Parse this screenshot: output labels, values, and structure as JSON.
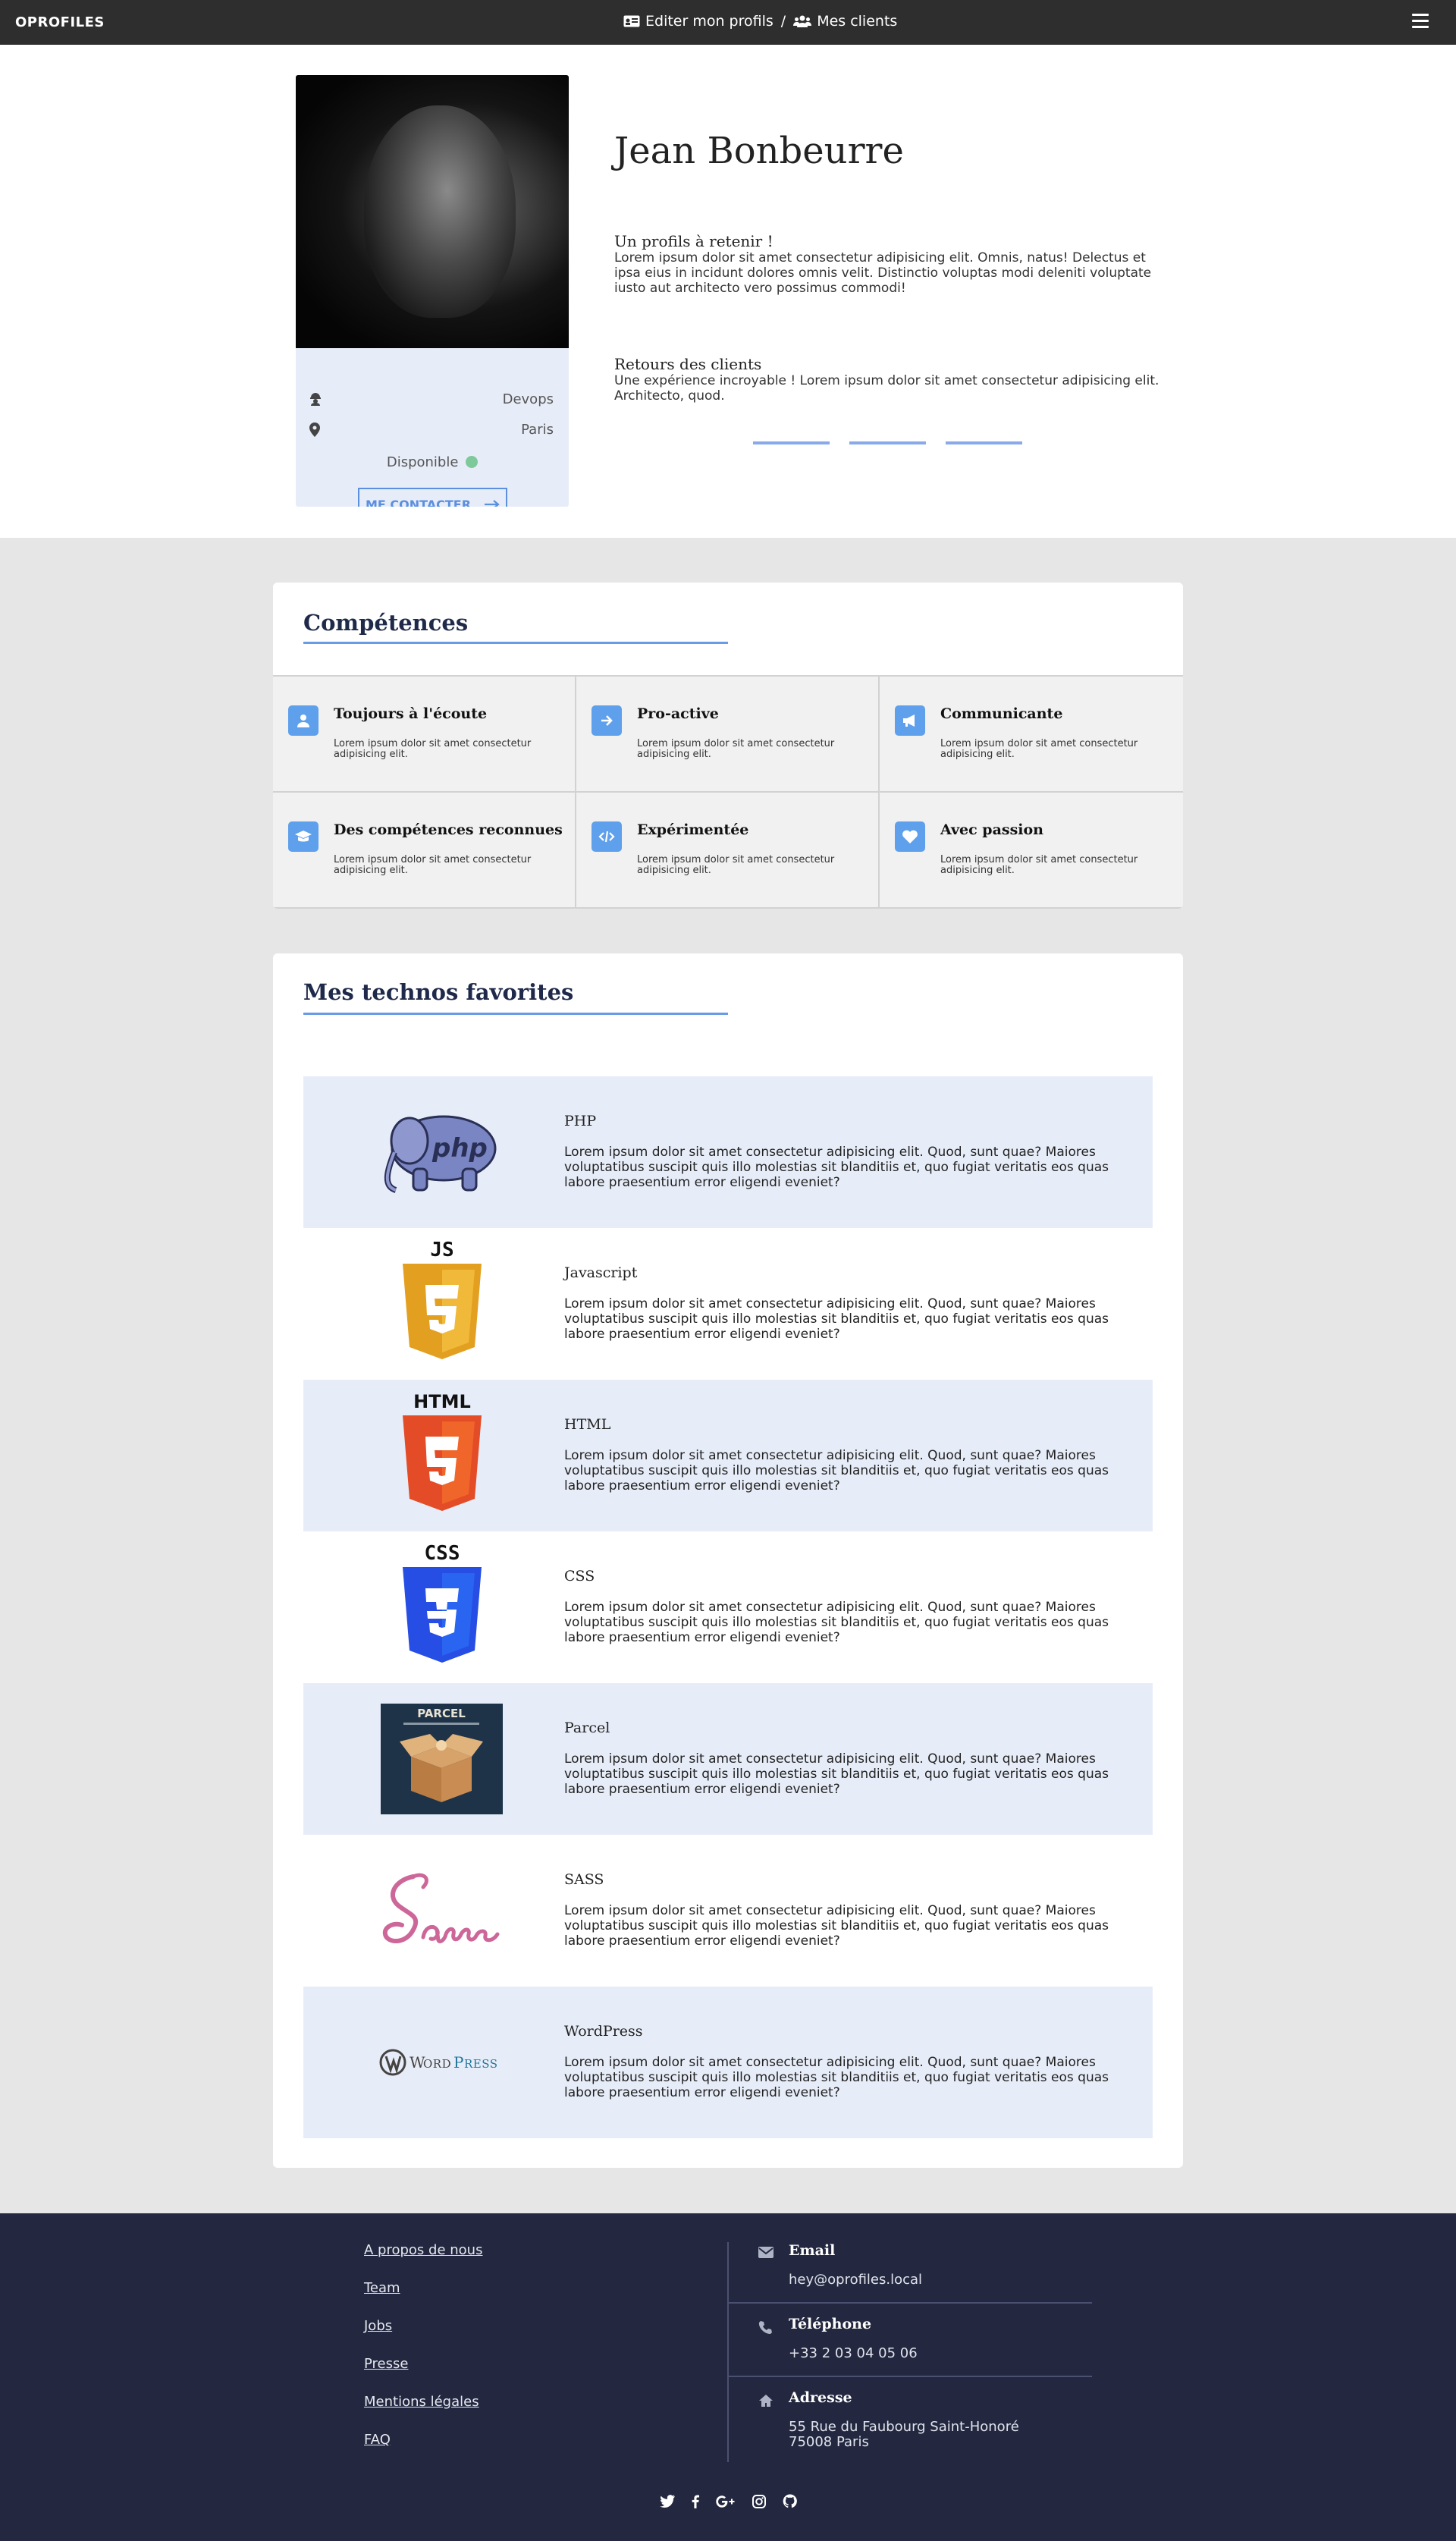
{
  "nav": {
    "brand": "OPROFILES",
    "edit_profile": "Editer mon profils",
    "separator": "/",
    "clients": "Mes clients",
    "icons": [
      "id-card-icon",
      "users-icon",
      "hamburger-menu-icon"
    ]
  },
  "profile": {
    "name": "Jean Bonbeurre",
    "job": "Devops",
    "city": "Paris",
    "availability": "Disponible",
    "availability_color": "#7ec99a",
    "contact_button": "ME CONTACTER",
    "bio_title": "Un profils à retenir !",
    "bio_text": "Lorem ipsum dolor sit amet consectetur adipisicing elit. Omnis, natus! Delectus et ipsa eius in incidunt dolores omnis velit. Distinctio voluptas modi deleniti voluptate iusto aut architecto vero possimus commodi!",
    "reviews_title": "Retours des clients",
    "reviews_text": "Une expérience incroyable ! Lorem ipsum dolor sit amet consectetur adipisicing elit. Architecto, quod."
  },
  "skills": {
    "title": "Compétences",
    "items": [
      {
        "title": "Toujours à l'écoute",
        "text": "Lorem ipsum dolor sit amet consectetur adipisicing elit.",
        "icon": "user-icon"
      },
      {
        "title": "Pro-active",
        "text": "Lorem ipsum dolor sit amet consectetur adipisicing elit.",
        "icon": "arrow-right-icon"
      },
      {
        "title": "Communicante",
        "text": "Lorem ipsum dolor sit amet consectetur adipisicing elit.",
        "icon": "megaphone-icon"
      },
      {
        "title": "Des compétences reconnues",
        "text": "Lorem ipsum dolor sit amet consectetur adipisicing elit.",
        "icon": "graduation-cap-icon"
      },
      {
        "title": "Expérimentée",
        "text": "Lorem ipsum dolor sit amet consectetur adipisicing elit.",
        "icon": "code-icon"
      },
      {
        "title": "Avec passion",
        "text": "Lorem ipsum dolor sit amet consectetur adipisicing elit.",
        "icon": "heart-icon"
      }
    ]
  },
  "technos": {
    "title": "Mes technos favorites",
    "items": [
      {
        "name": "PHP",
        "text": "Lorem ipsum dolor sit amet consectetur adipisicing elit. Quod, sunt quae? Maiores voluptatibus suscipit quis illo molestias sit blanditiis et, quo fugiat veritatis eos quas labore praesentium error eligendi eveniet?"
      },
      {
        "name": "Javascript",
        "text": "Lorem ipsum dolor sit amet consectetur adipisicing elit. Quod, sunt quae? Maiores voluptatibus suscipit quis illo molestias sit blanditiis et, quo fugiat veritatis eos quas labore praesentium error eligendi eveniet?",
        "logo_label": "JS"
      },
      {
        "name": "HTML",
        "text": "Lorem ipsum dolor sit amet consectetur adipisicing elit. Quod, sunt quae? Maiores voluptatibus suscipit quis illo molestias sit blanditiis et, quo fugiat veritatis eos quas labore praesentium error eligendi eveniet?",
        "logo_label": "HTML"
      },
      {
        "name": "CSS",
        "text": "Lorem ipsum dolor sit amet consectetur adipisicing elit. Quod, sunt quae? Maiores voluptatibus suscipit quis illo molestias sit blanditiis et, quo fugiat veritatis eos quas labore praesentium error eligendi eveniet?",
        "logo_label": "CSS"
      },
      {
        "name": "Parcel",
        "text": "Lorem ipsum dolor sit amet consectetur adipisicing elit. Quod, sunt quae? Maiores voluptatibus suscipit quis illo molestias sit blanditiis et, quo fugiat veritatis eos quas labore praesentium error eligendi eveniet?",
        "logo_label": "PARCEL"
      },
      {
        "name": "SASS",
        "text": "Lorem ipsum dolor sit amet consectetur adipisicing elit. Quod, sunt quae? Maiores voluptatibus suscipit quis illo molestias sit blanditiis et, quo fugiat veritatis eos quas labore praesentium error eligendi eveniet?"
      },
      {
        "name": "WordPress",
        "text": "Lorem ipsum dolor sit amet consectetur adipisicing elit. Quod, sunt quae? Maiores voluptatibus suscipit quis illo molestias sit blanditiis et, quo fugiat veritatis eos quas labore praesentium error eligendi eveniet?"
      }
    ]
  },
  "footer": {
    "links": [
      "A propos de nous",
      "Team",
      "Jobs",
      "Presse",
      "Mentions légales",
      "FAQ"
    ],
    "email_label": "Email",
    "email": "hey@oprofiles.local",
    "phone_label": "Téléphone",
    "phone": "+33 2 03 04 05 06",
    "address_label": "Adresse",
    "address_line1": "55 Rue du Faubourg Saint-Honoré",
    "address_line2": "75008 Paris",
    "social_icons": [
      "twitter-icon",
      "facebook-icon",
      "google-plus-icon",
      "instagram-icon",
      "github-icon"
    ]
  },
  "colors": {
    "navbar": "#2e2e2e",
    "accent": "#5b8fe0",
    "card_bg": "#e7edf8",
    "footer": "#232840",
    "page_bg": "#e6e6e6"
  }
}
